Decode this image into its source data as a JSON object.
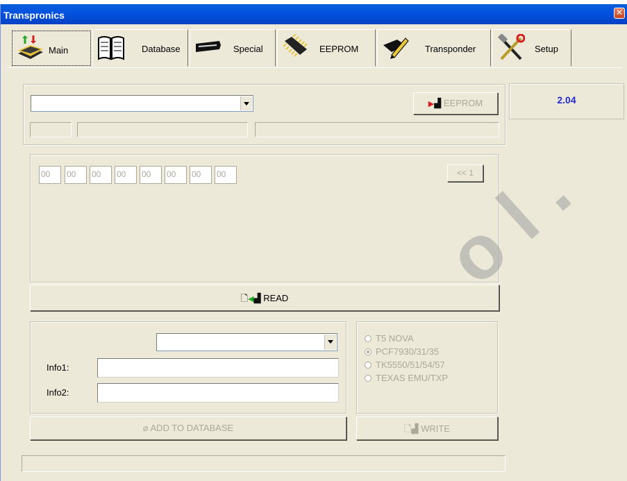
{
  "window": {
    "title": "Transpronics"
  },
  "tabs": [
    {
      "label": "Main",
      "icon": "chip-board-icon"
    },
    {
      "label": "Database",
      "icon": "book-icon"
    },
    {
      "label": "Special",
      "icon": "key-blade-icon"
    },
    {
      "label": "EEPROM",
      "icon": "eeprom-chip-icon"
    },
    {
      "label": "Transponder",
      "icon": "pencil-chip-icon"
    },
    {
      "label": "Setup",
      "icon": "tools-icon"
    }
  ],
  "main": {
    "device_select": {
      "value": ""
    },
    "eeprom_button": "EEPROM",
    "hex_values": [
      "00",
      "00",
      "00",
      "00",
      "00",
      "00",
      "00",
      "00"
    ],
    "page_button": "<< 1",
    "read_button": "READ",
    "info_select": {
      "value": ""
    },
    "info1_label": "Info1:",
    "info2_label": "Info2:",
    "info1_value": "",
    "info2_value": "",
    "add_button": "ADD TO DATABASE",
    "radio_options": [
      {
        "label": "T5 NOVA",
        "selected": false
      },
      {
        "label": "PCF7930/31/35",
        "selected": true
      },
      {
        "label": "TK5550/51/54/57",
        "selected": false
      },
      {
        "label": "TEXAS EMU/TXP",
        "selected": false
      }
    ],
    "write_button": "WRITE"
  },
  "version": "2.04",
  "colors": {
    "titlebar": "#0453e0",
    "version_text": "#1f2ad4",
    "disabled_text": "#aca899"
  }
}
